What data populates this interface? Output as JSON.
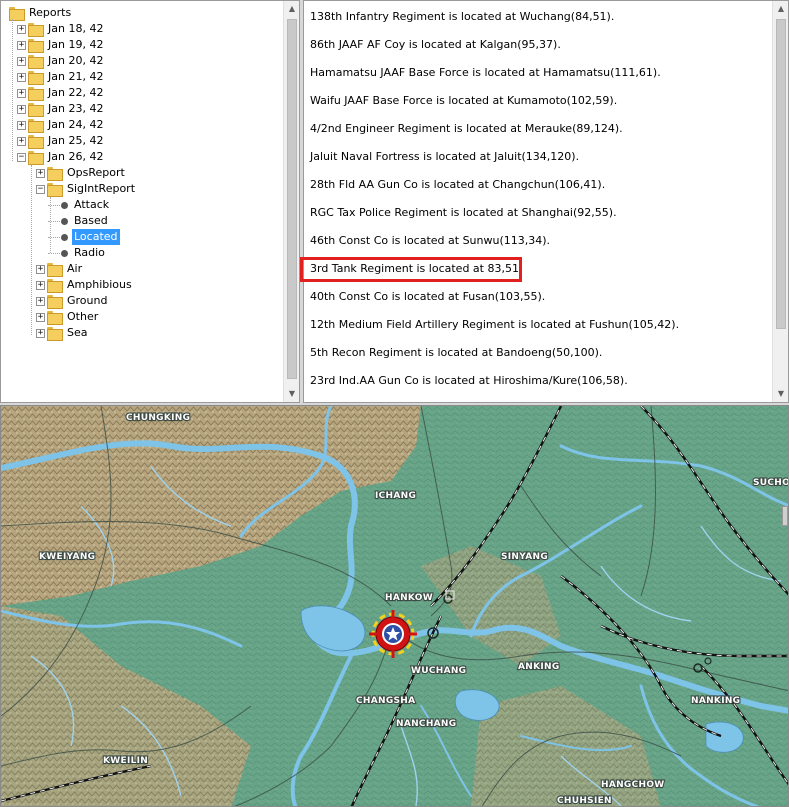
{
  "tree": {
    "root": "Reports",
    "dates": [
      "Jan 18, 42",
      "Jan 19, 42",
      "Jan 20, 42",
      "Jan 21, 42",
      "Jan 22, 42",
      "Jan 23, 42",
      "Jan 24, 42",
      "Jan 25, 42",
      "Jan 26, 42"
    ],
    "categories": {
      "ops": "OpsReport",
      "sigint": "SigIntReport",
      "sigint_children": [
        "Attack",
        "Based",
        "Located",
        "Radio"
      ],
      "others": [
        "Air",
        "Amphibious",
        "Ground",
        "Other",
        "Sea"
      ]
    },
    "selected": "Located"
  },
  "report": {
    "lines": [
      "138th Infantry Regiment is located at Wuchang(84,51).",
      "86th JAAF AF Coy  is located at Kalgan(95,37).",
      "Hamamatsu JAAF Base Force is located at Hamamatsu(111,61).",
      "Waifu JAAF Base Force is located at Kumamoto(102,59).",
      "4/2nd Engineer Regiment is located at Merauke(89,124).",
      "Jaluit Naval Fortress is located at Jaluit(134,120).",
      "28th Fld AA Gun Co  is located at Changchun(106,41).",
      "RGC Tax Police Regiment is located at Shanghai(92,55).",
      "46th Const Co  is located at Sunwu(113,34).",
      "3rd Tank Regiment is located at 83,51.",
      "40th Const Co  is located at Fusan(103,55).",
      "12th Medium Field Artillery Regiment is located at Fushun(105,42).",
      "5th Recon Regiment is located at Bandoeng(50,100).",
      "23rd Ind.AA Gun Co  is located at Hiroshima/Kure(106,58)."
    ],
    "highlighted_index": 9
  },
  "map": {
    "cities": [
      "CHUNGKING",
      "ICHANG",
      "KWEIYANG",
      "HANKOW",
      "SINYANG",
      "WUCHANG",
      "ANKING",
      "CHANGSHA",
      "NANCHANG",
      "NANKING",
      "KWEILIN",
      "HANGCHOW",
      "CHUHSIEN",
      "SUCHO"
    ],
    "marker": "target-marker"
  },
  "colors": {
    "highlight_border": "#e32020",
    "selection": "#3399ff",
    "water": "#7ec3e8",
    "lowland": "#5d9e85",
    "highland": "#b89a72"
  }
}
